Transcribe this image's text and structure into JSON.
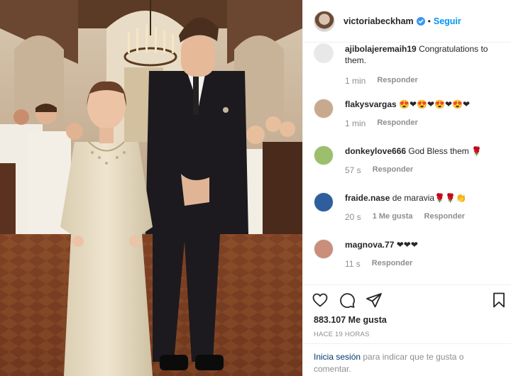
{
  "post": {
    "author": "victoriabeckham",
    "verified": true,
    "follow_label": "Seguir",
    "separator": "•"
  },
  "comments": [
    {
      "user": "ajibolajeremaih19",
      "text": "Congratulations to them.",
      "time": "1 min",
      "likes": "",
      "reply": "Responder",
      "avatar_color": "#e8e8e8"
    },
    {
      "user": "flakysvargas",
      "text": "😍❤😍❤😍❤😍❤",
      "time": "1 min",
      "likes": "",
      "reply": "Responder",
      "avatar_color": "#c9a98d"
    },
    {
      "user": "donkeylove666",
      "text": "God Bless them 🌹",
      "time": "57 s",
      "likes": "",
      "reply": "Responder",
      "avatar_color": "#9bbf6a"
    },
    {
      "user": "fraide.nase",
      "text": "de maravia🌹🌹👏",
      "time": "20 s",
      "likes": "1 Me gusta",
      "reply": "Responder",
      "avatar_color": "#2f5e9e"
    },
    {
      "user": "magnova.77",
      "text": "❤❤❤",
      "time": "11 s",
      "likes": "",
      "reply": "Responder",
      "avatar_color": "#c98f7a"
    }
  ],
  "actions": {
    "like_icon": "heart-icon",
    "comment_icon": "comment-icon",
    "share_icon": "share-icon",
    "save_icon": "bookmark-icon",
    "likes_text": "883.107 Me gusta",
    "time_ago": "HACE 19 HORAS"
  },
  "login": {
    "link_text": "Inicia sesión",
    "rest_text": " para indicar que te gusta o comentar."
  },
  "colors": {
    "accent": "#0095f6",
    "link": "#00376b",
    "muted": "#8e8e8e",
    "verified": "#3897f0"
  }
}
